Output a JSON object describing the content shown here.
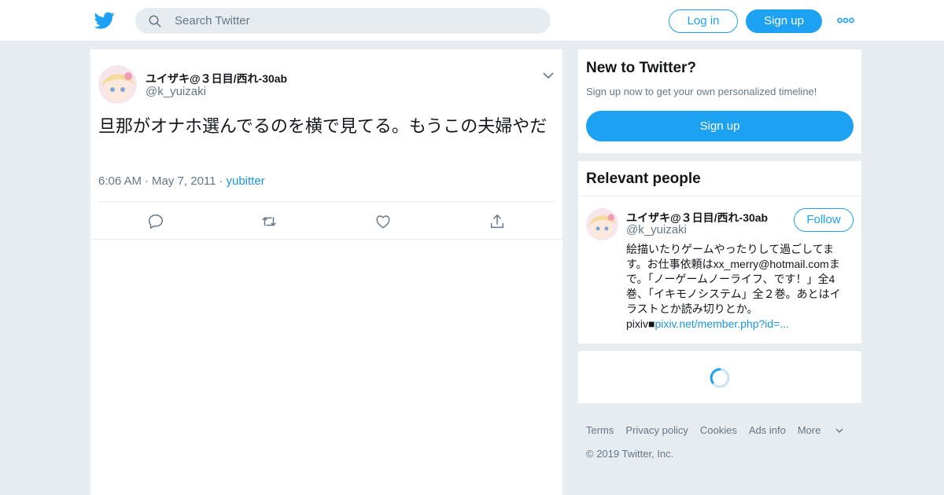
{
  "header": {
    "logo": "twitter-bird-icon",
    "search_placeholder": "Search Twitter",
    "login_label": "Log in",
    "signup_label": "Sign up",
    "more_icon": "more-dots-icon",
    "brand_color": "#1da1f2"
  },
  "tweet": {
    "author_name": "ユイザキ@３日目/西れ-30ab",
    "author_handle": "@k_yuizaki",
    "text": "旦那がオナホ選んでるのを横で見てる。もうこの夫婦やだ",
    "time": "6:06 AM",
    "date": "May 7, 2011",
    "source": "yubitter",
    "actions": [
      "reply-icon",
      "retweet-icon",
      "like-icon",
      "share-icon"
    ]
  },
  "new_to_twitter": {
    "title": "New to Twitter?",
    "subtitle": "Sign up now to get your own personalized timeline!",
    "signup_label": "Sign up"
  },
  "relevant_people": {
    "title": "Relevant people",
    "name": "ユイザキ@３日目/西れ-30ab",
    "handle": "@k_yuizaki",
    "follow_label": "Follow",
    "bio_text": "絵描いたりゲームやったりして過ごしてます。お仕事依頼はxx_merry@hotmail.comまで。「ノーゲームノーライフ、です！」全4巻、「イキモノシステム」全２巻。あとはイラストとか読み切りとか。pixiv■",
    "bio_link": "pixiv.net/member.php?id=..."
  },
  "footer": {
    "terms": "Terms",
    "privacy": "Privacy policy",
    "cookies": "Cookies",
    "ads_info": "Ads info",
    "more": "More",
    "copyright": "© 2019 Twitter, Inc."
  }
}
